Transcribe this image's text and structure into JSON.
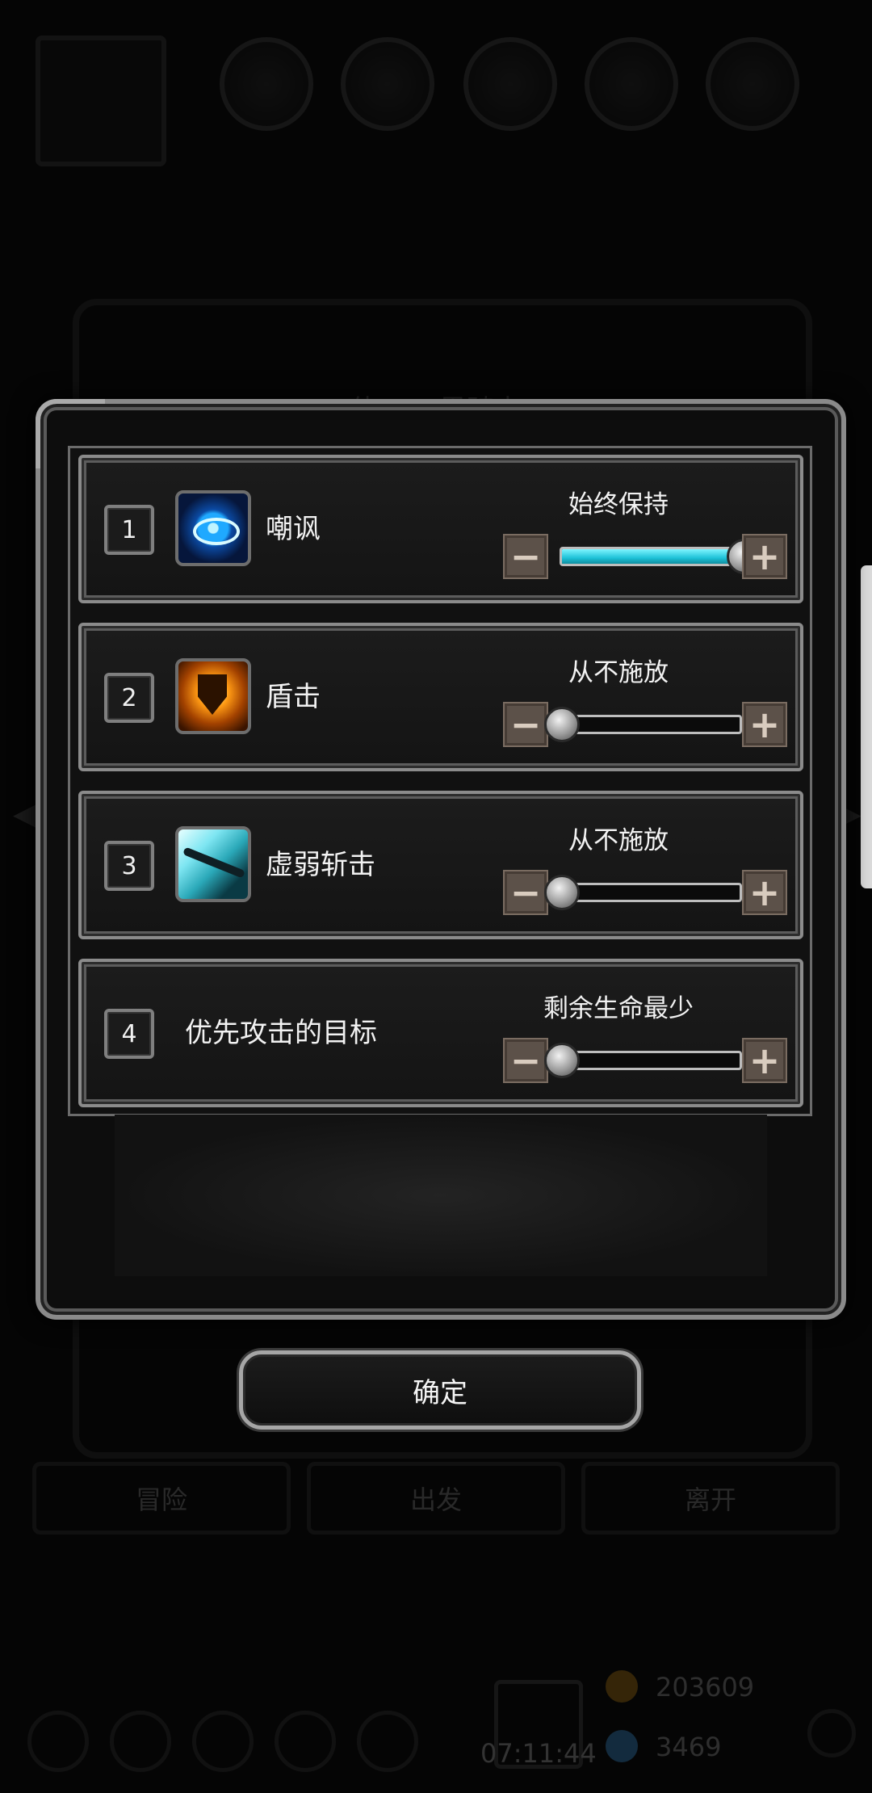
{
  "background": {
    "title": "体743 黑骑士",
    "tabs": [
      "冒险",
      "出发",
      "离开"
    ],
    "gold": "203609",
    "gems": "3469",
    "time": "07:11:44"
  },
  "dialog": {
    "rows": [
      {
        "index": "1",
        "name": "嘲讽",
        "mode": "始终保持",
        "slider_level": 1.0,
        "icon": "eye-icon"
      },
      {
        "index": "2",
        "name": "盾击",
        "mode": "从不施放",
        "slider_level": 0.0,
        "icon": "shield-icon"
      },
      {
        "index": "3",
        "name": "虚弱斩击",
        "mode": "从不施放",
        "slider_level": 0.0,
        "icon": "slash-icon"
      },
      {
        "index": "4",
        "name": "优先攻击的目标",
        "mode": "剩余生命最少",
        "slider_level": 0.0,
        "icon": ""
      }
    ],
    "minus_symbol": "−",
    "plus_symbol": "+",
    "confirm_label": "确定"
  },
  "colors": {
    "slider_fill": "#1ec2d8",
    "step_button": "#5c5149",
    "frame": "#8a8a8a"
  }
}
